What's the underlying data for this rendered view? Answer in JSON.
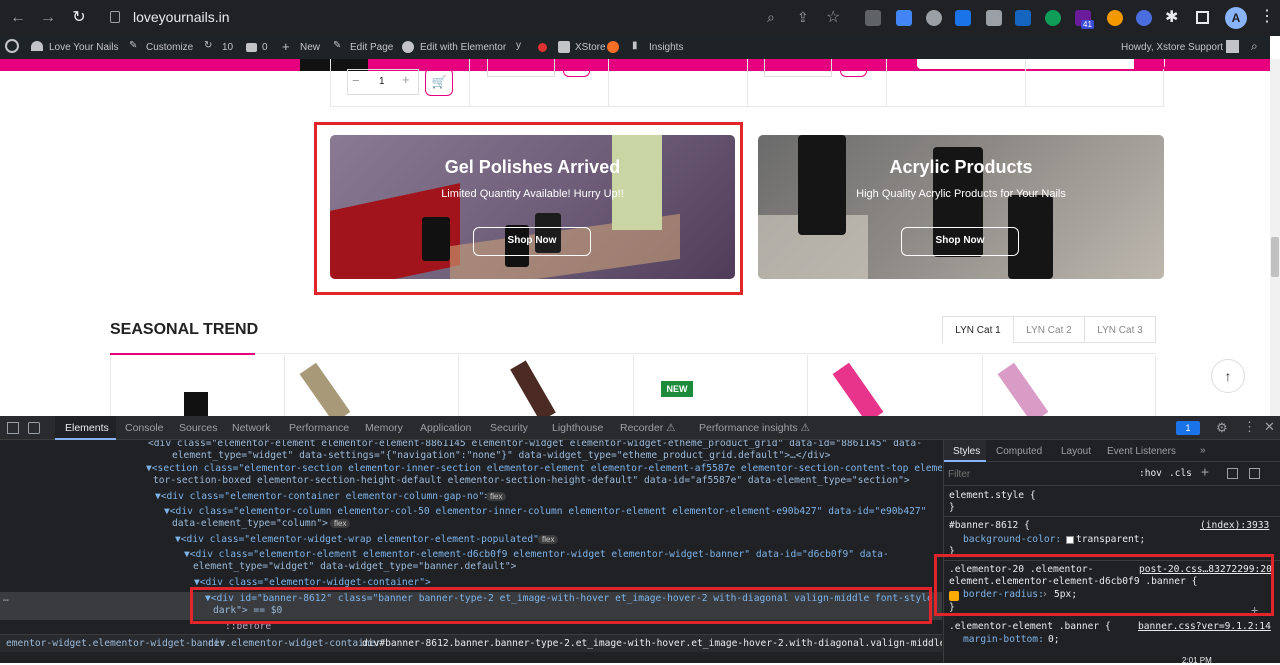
{
  "browser": {
    "url": "loveyournails.in",
    "profile_initial": "A",
    "ext_badge": "41"
  },
  "wpbar": {
    "site": "Love Your Nails",
    "customize": "Customize",
    "updates": "10",
    "comments": "0",
    "new": "New",
    "edit_page": "Edit Page",
    "elementor": "Edit with Elementor",
    "xstore": "XStore",
    "insights": "Insights",
    "howdy": "Howdy, Xstore Support"
  },
  "page": {
    "qty": "1",
    "banner1": {
      "title": "Gel Polishes Arrived",
      "subtitle": "Limited Quantity Available! Hurry Up!!",
      "button": "Shop Now"
    },
    "banner2": {
      "title": "Acrylic Products",
      "subtitle": "High Quality Acrylic Products for Your Nails",
      "button": "Shop Now"
    },
    "section_title": "SEASONAL TREND",
    "tabs": [
      "LYN Cat 1",
      "LYN Cat 2",
      "LYN Cat 3"
    ],
    "new_badge": "NEW"
  },
  "devtools": {
    "tabs": [
      "Elements",
      "Console",
      "Sources",
      "Network",
      "Performance",
      "Memory",
      "Application",
      "Security",
      "Lighthouse",
      "Recorder ⚠",
      "Performance insights ⚠"
    ],
    "issues_count": "1",
    "code_lines": [
      "<div class=\"elementor-element elementor-element-8861145 elementor-widget elementor-widget-etheme_product_grid\" data-id=\"8861145\" data-",
      "element_type=\"widget\" data-settings=\"{\"navigation\":\"none\"}\" data-widget_type=\"etheme_product_grid.default\">…</div>",
      "▼<section class=\"elementor-section elementor-inner-section elementor-element elementor-element-af5587e elementor-section-content-top elemen",
      "tor-section-boxed elementor-section-height-default elementor-section-height-default\" data-id=\"af5587e\" data-element_type=\"section\">",
      "▼<div class=\"elementor-container elementor-column-gap-no\">",
      "▼<div class=\"elementor-column elementor-col-50 elementor-inner-column elementor-element elementor-element-e90b427\" data-id=\"e90b427\"",
      "data-element_type=\"column\">",
      "▼<div class=\"elementor-widget-wrap elementor-element-populated\">",
      "▼<div class=\"elementor-element elementor-element-d6cb0f9 elementor-widget elementor-widget-banner\" data-id=\"d6cb0f9\" data-",
      "element_type=\"widget\" data-widget_type=\"banner.default\">",
      "▼<div class=\"elementor-widget-container\">",
      "▼<div id=\"banner-8612\" class=\"banner  banner-type-2 et_image-with-hover et_image-hover-2 with-diagonal valign-middle font-style-",
      "dark\"> == $0",
      "::before"
    ],
    "breadcrumb": [
      "ementor-widget.elementor-widget-banner",
      "div.elementor-widget-container",
      "div#banner-8612.banner.banner-type-2.et_image-with-hover.et_image-hover-2.with-diagonal.valign-middle.font-style-dark"
    ],
    "styles_tabs": [
      "Styles",
      "Computed",
      "Layout",
      "Event Listeners",
      "»"
    ],
    "filter_placeholder": "Filter",
    "hov": ":hov",
    "cls": ".cls",
    "rules": {
      "element_style": "element.style {",
      "r1_sel": "#banner-8612 {",
      "r1_src": "(index):3933",
      "r1_prop": "background-color:",
      "r1_val": "transparent;",
      "r2_sel1": ".elementor-20 .elementor-",
      "r2_sel2": "element.elementor-element-d6cb0f9 .banner {",
      "r2_src": "post-20.css…83272299:20",
      "r2_prop": "border-radius:",
      "r2_val": "5px;",
      "r3_sel": ".elementor-element .banner {",
      "r3_src": "banner.css?ver=9.1.2:14",
      "r3_prop": "margin-bottom:",
      "r3_val": "0;"
    },
    "clock": "2:01 PM"
  }
}
